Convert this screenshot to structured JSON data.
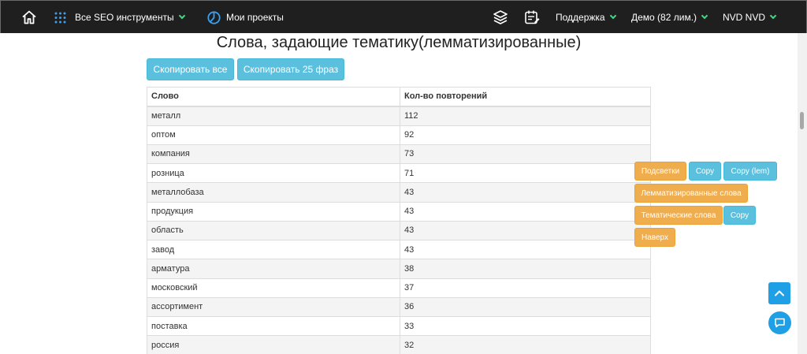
{
  "navbar": {
    "home_icon": "home-icon",
    "tools_icon": "grid-icon",
    "tools_label": "Все SEO инструменты",
    "projects_icon": "chart-circle-icon",
    "projects_label": "Мои проекты",
    "layers_icon": "layers-icon",
    "calendar_icon": "calendar-edit-icon",
    "support_label": "Поддержка",
    "demo_label": "Демо (82 лим.)",
    "user_label": "NVD NVD"
  },
  "page": {
    "title": "Слова, задающие тематику(лемматизированные)"
  },
  "actions": {
    "copy_all": "Скопировать все",
    "copy_25": "Скопировать 25 фраз"
  },
  "table": {
    "headers": [
      "Слово",
      "Кол-во повторений"
    ],
    "rows": [
      [
        "металл",
        "112"
      ],
      [
        "оптом",
        "92"
      ],
      [
        "компания",
        "73"
      ],
      [
        "розница",
        "71"
      ],
      [
        "металлобаза",
        "43"
      ],
      [
        "продукция",
        "43"
      ],
      [
        "область",
        "43"
      ],
      [
        "завод",
        "43"
      ],
      [
        "арматура",
        "38"
      ],
      [
        "московский",
        "37"
      ],
      [
        "ассортимент",
        "36"
      ],
      [
        "поставка",
        "33"
      ],
      [
        "россия",
        "32"
      ]
    ]
  },
  "side_panel": {
    "highlights": "Подсветки",
    "copy": "Copy",
    "copy_lem": "Copy (lem)",
    "lemmatized_words": "Лемматизированные слова",
    "thematic_words": "Тематические слова",
    "copy_thematic": "Copy",
    "to_top": "Наверх"
  },
  "colors": {
    "navbar_bg": "#1f1f1f",
    "accent_green": "#3ddc84",
    "info_blue": "#5bc0de",
    "warning_orange": "#f0ad4e",
    "fab_blue": "#1e9fe6"
  },
  "floating": {
    "scroll_up_icon": "chevron-up-icon",
    "chat_icon": "chat-bubble-icon"
  }
}
